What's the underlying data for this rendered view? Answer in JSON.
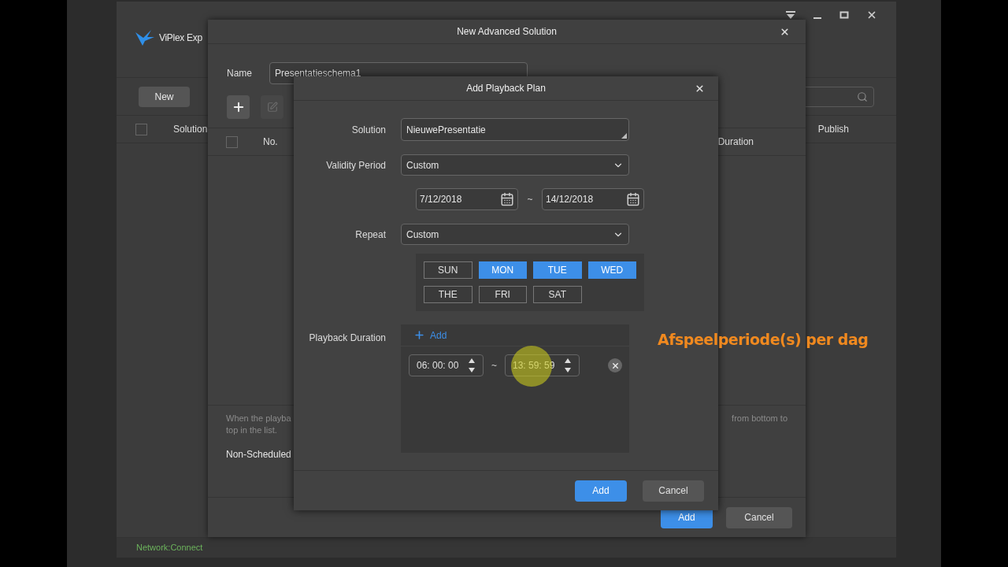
{
  "app": {
    "title": "ViPlex Exp",
    "toolbar_button": "New",
    "columns": [
      {
        "label": "Solution",
        "checked": false
      },
      {
        "label": "Publish"
      }
    ],
    "status": "Network:Connect"
  },
  "advanced_dialog": {
    "title": "New Advanced Solution",
    "name_label": "Name",
    "name_value": "Presentatieschema1",
    "tools": [
      {
        "kind": "add",
        "disabled": false
      },
      {
        "kind": "edit",
        "disabled": true
      }
    ],
    "header_checked": false,
    "columns": [
      "No.",
      "Duration"
    ],
    "note_left": [
      "When the playba",
      "top in the list."
    ],
    "note_right": "from bottom to",
    "non_scheduled": "Non-Scheduled",
    "buttons": [
      {
        "label": "Add",
        "kind": "primary"
      },
      {
        "label": "Cancel",
        "kind": "secondary"
      }
    ]
  },
  "playback_dialog": {
    "title": "Add Playback Plan",
    "solution": {
      "label": "Solution",
      "value": "NieuwePresentatie"
    },
    "validity": {
      "label": "Validity Period",
      "value": "Custom",
      "start": "7/12/2018",
      "separator": "~",
      "end": "14/12/2018"
    },
    "repeat": {
      "label": "Repeat",
      "value": "Custom"
    },
    "days": [
      {
        "label": "SUN",
        "selected": false
      },
      {
        "label": "MON",
        "selected": true
      },
      {
        "label": "TUE",
        "selected": true
      },
      {
        "label": "WED",
        "selected": true
      },
      {
        "label": "THE",
        "selected": false
      },
      {
        "label": "FRI",
        "selected": false
      },
      {
        "label": "SAT",
        "selected": false
      }
    ],
    "duration": {
      "label": "Playback Duration",
      "add": "Add",
      "ranges": [
        {
          "start": "06: 00: 00",
          "separator": "~",
          "end": "13: 59: 59"
        }
      ]
    },
    "buttons": [
      {
        "label": "Add",
        "kind": "primary"
      },
      {
        "label": "Cancel",
        "kind": "secondary"
      }
    ]
  },
  "annotation": "Afspeelperiode(s) per dag"
}
